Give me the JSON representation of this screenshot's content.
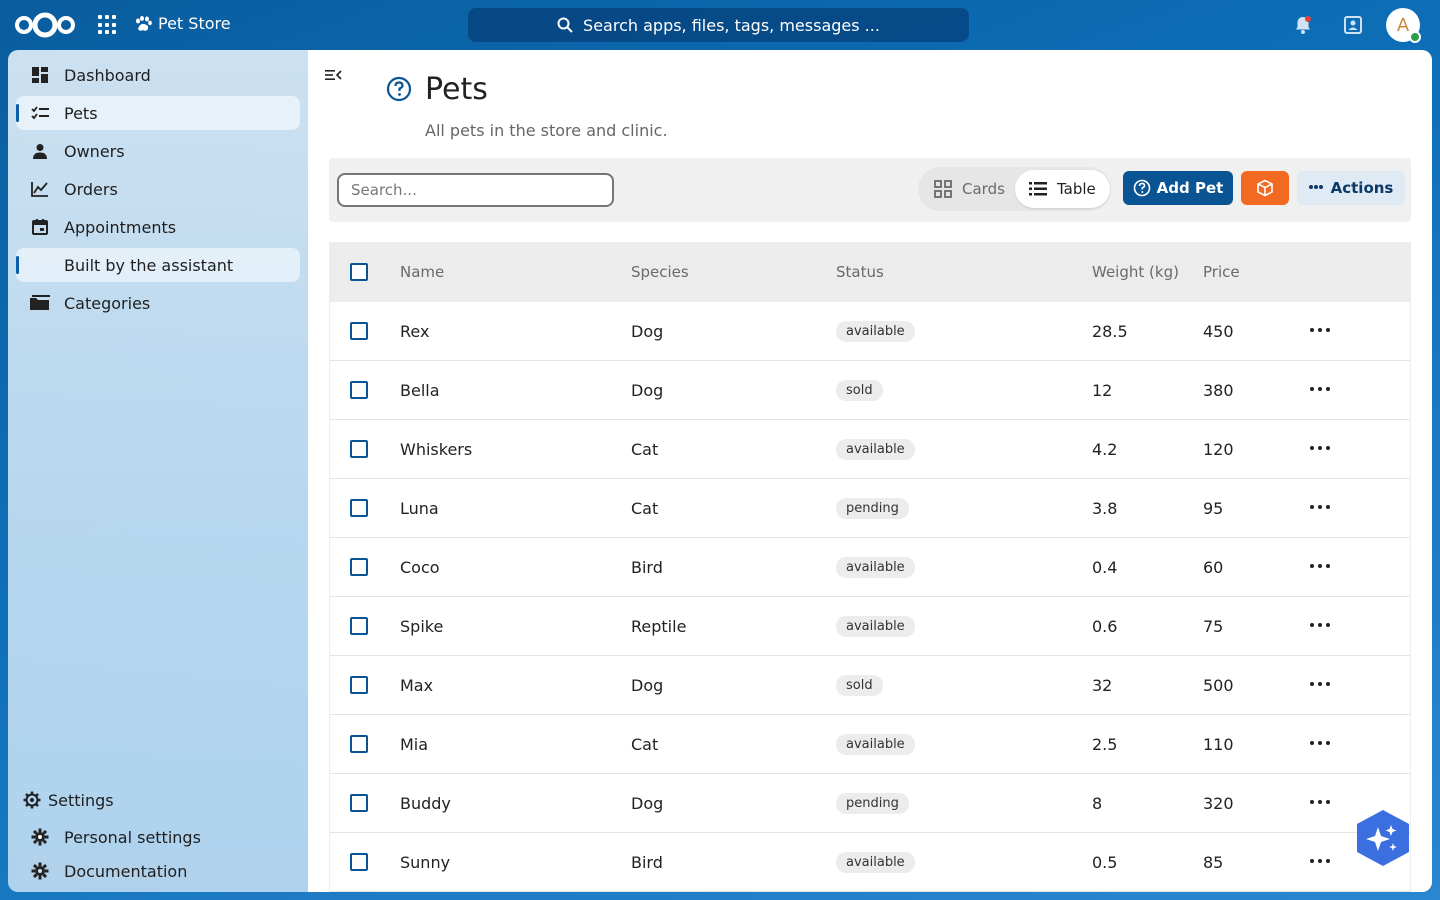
{
  "header": {
    "app_name": "Pet Store",
    "search_placeholder": "Search apps, files, tags, messages ...",
    "avatar_initial": "A"
  },
  "sidebar": {
    "items": [
      {
        "label": "Dashboard",
        "icon": "dashboard-icon",
        "active": false
      },
      {
        "label": "Pets",
        "icon": "checklist-icon",
        "active": true
      },
      {
        "label": "Owners",
        "icon": "person-icon",
        "active": false
      },
      {
        "label": "Orders",
        "icon": "chart-line-icon",
        "active": false
      },
      {
        "label": "Appointments",
        "icon": "calendar-icon",
        "active": false
      },
      {
        "label": "Built by the assistant",
        "icon": "",
        "active": true
      },
      {
        "label": "Categories",
        "icon": "folder-icon",
        "active": false
      }
    ],
    "bottom": [
      {
        "label": "Settings",
        "icon": "gear-icon"
      },
      {
        "label": "Personal settings",
        "icon": "gear-icon"
      },
      {
        "label": "Documentation",
        "icon": "gear-icon"
      }
    ]
  },
  "page": {
    "title": "Pets",
    "subtitle": "All pets in the store and clinic."
  },
  "toolbar": {
    "search_placeholder": "Search...",
    "cards_label": "Cards",
    "table_label": "Table",
    "add_label": "Add Pet",
    "actions_label": "Actions"
  },
  "table": {
    "columns": [
      "Name",
      "Species",
      "Status",
      "Weight (kg)",
      "Price"
    ],
    "rows": [
      {
        "name": "Rex",
        "species": "Dog",
        "status": "available",
        "weight": "28.5",
        "price": "450"
      },
      {
        "name": "Bella",
        "species": "Dog",
        "status": "sold",
        "weight": "12",
        "price": "380"
      },
      {
        "name": "Whiskers",
        "species": "Cat",
        "status": "available",
        "weight": "4.2",
        "price": "120"
      },
      {
        "name": "Luna",
        "species": "Cat",
        "status": "pending",
        "weight": "3.8",
        "price": "95"
      },
      {
        "name": "Coco",
        "species": "Bird",
        "status": "available",
        "weight": "0.4",
        "price": "60"
      },
      {
        "name": "Spike",
        "species": "Reptile",
        "status": "available",
        "weight": "0.6",
        "price": "75"
      },
      {
        "name": "Max",
        "species": "Dog",
        "status": "sold",
        "weight": "32",
        "price": "500"
      },
      {
        "name": "Mia",
        "species": "Cat",
        "status": "available",
        "weight": "2.5",
        "price": "110"
      },
      {
        "name": "Buddy",
        "species": "Dog",
        "status": "pending",
        "weight": "8",
        "price": "320"
      },
      {
        "name": "Sunny",
        "species": "Bird",
        "status": "available",
        "weight": "0.5",
        "price": "85"
      }
    ]
  },
  "colors": {
    "header_bg": "#0d6fb8",
    "primary": "#0b5494",
    "accent_orange": "#f26a21",
    "assistant_fab": "#3b6fe0"
  }
}
